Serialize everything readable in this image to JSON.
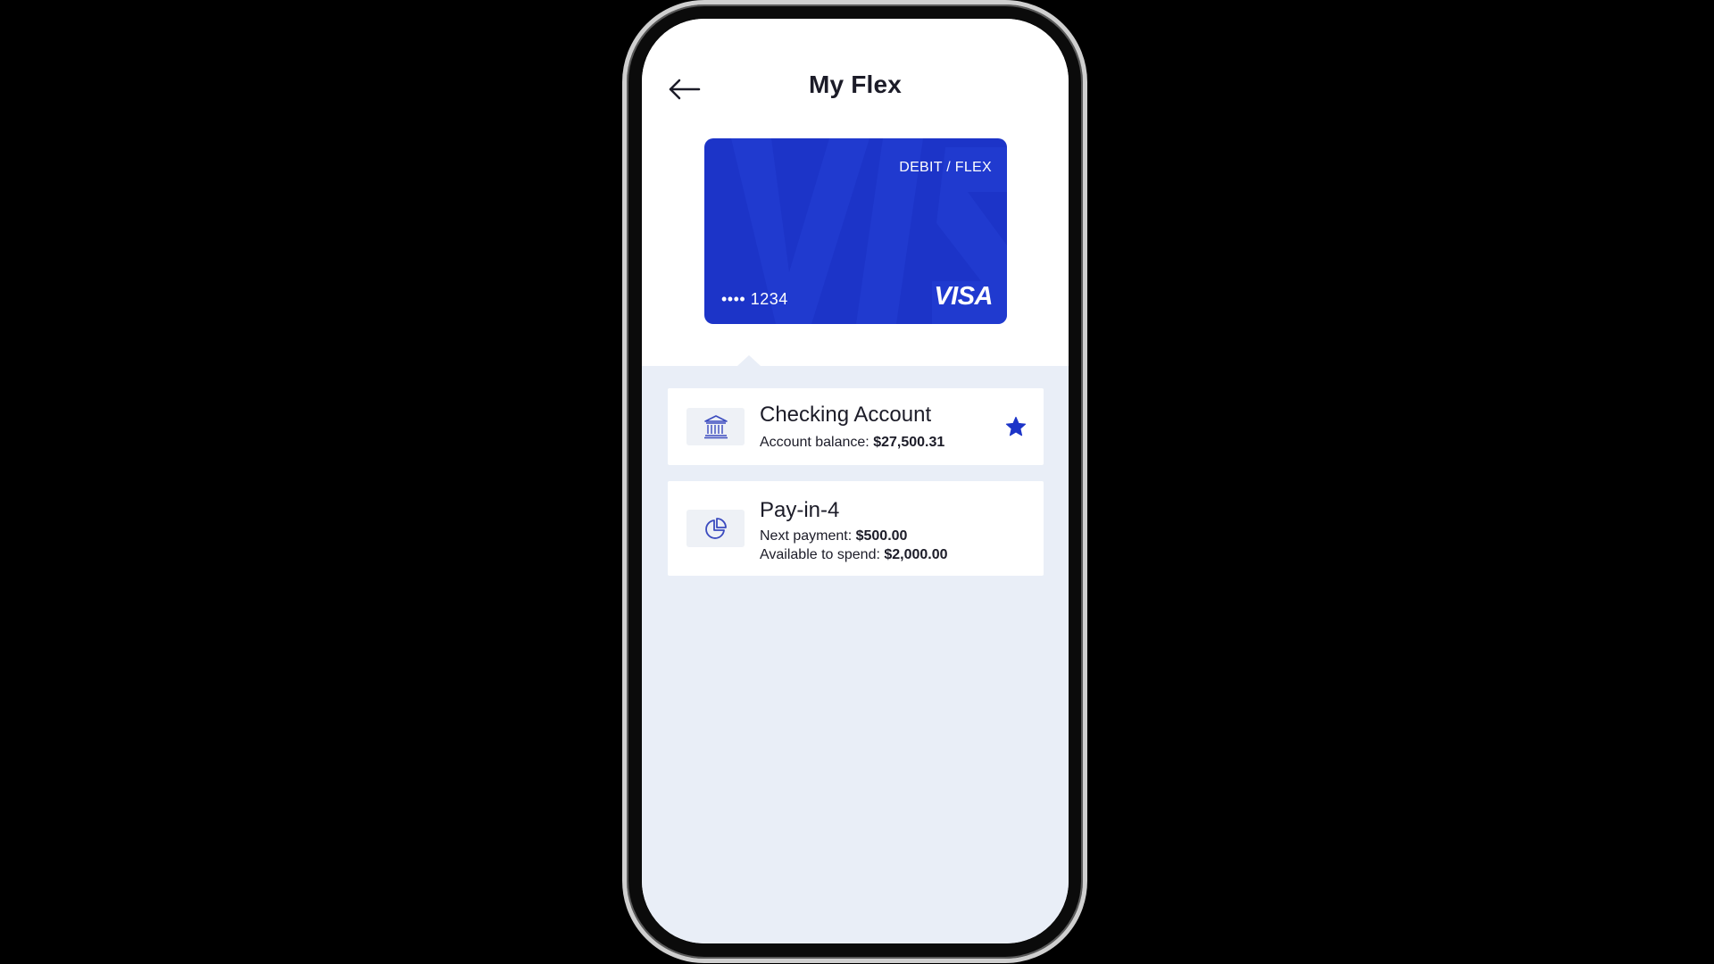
{
  "header": {
    "title": "My Flex",
    "back_icon": "arrow-left-icon"
  },
  "card": {
    "type_label": "DEBIT / FLEX",
    "number_masked": "•••• 1234",
    "brand": "VISA",
    "color": "#1c34c8"
  },
  "accounts": [
    {
      "title": "Checking Account",
      "icon": "bank-icon",
      "lines": [
        {
          "label": "Account balance: ",
          "value": "$27,500.31"
        }
      ],
      "favorite": true,
      "favorite_icon": "star-icon"
    },
    {
      "title": "Pay-in-4",
      "icon": "pie-chart-icon",
      "lines": [
        {
          "label": "Next payment: ",
          "value": "$500.00"
        },
        {
          "label": "Available to spend: ",
          "value": "$2,000.00"
        }
      ]
    }
  ],
  "colors": {
    "accent": "#1c34c8",
    "background": "#e9eef7",
    "icon": "#3b4bbf"
  }
}
